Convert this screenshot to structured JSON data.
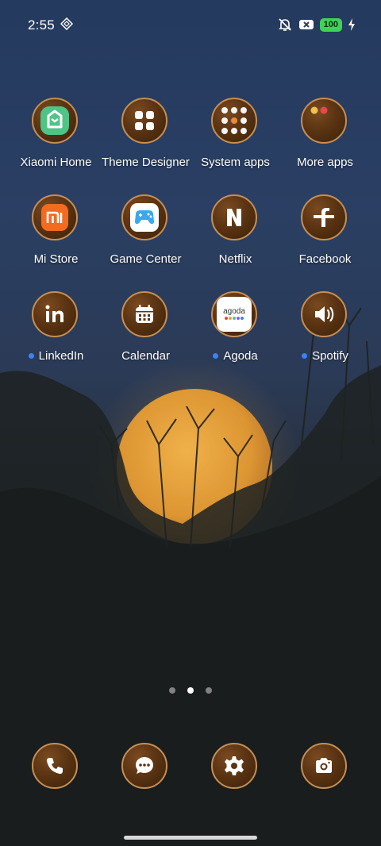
{
  "status_bar": {
    "time": "2:55",
    "battery_level": "100",
    "icons": [
      "nfc-icon",
      "mute-icon",
      "sim-x-icon",
      "battery-icon",
      "charging-icon"
    ]
  },
  "apps": [
    {
      "name": "Xiaomi Home",
      "icon": "xiaomi-home-icon",
      "notification": false
    },
    {
      "name": "Theme Designer",
      "icon": "grid-icon",
      "notification": false
    },
    {
      "name": "System apps",
      "icon": "folder-icon",
      "notification": false
    },
    {
      "name": "More apps",
      "icon": "folder-icon",
      "notification": false
    },
    {
      "name": "Mi Store",
      "icon": "mi-store-icon",
      "notification": false
    },
    {
      "name": "Game Center",
      "icon": "gamepad-icon",
      "notification": false
    },
    {
      "name": "Netflix",
      "icon": "netflix-icon",
      "notification": false
    },
    {
      "name": "Facebook",
      "icon": "facebook-icon",
      "notification": false
    },
    {
      "name": "LinkedIn",
      "icon": "linkedin-icon",
      "notification": true
    },
    {
      "name": "Calendar",
      "icon": "calendar-icon",
      "notification": false
    },
    {
      "name": "Agoda",
      "icon": "agoda-icon",
      "notification": true,
      "icon_text": "agoda"
    },
    {
      "name": "Spotify",
      "icon": "speaker-icon",
      "notification": true
    }
  ],
  "pager": {
    "pages": 3,
    "active": 2
  },
  "dock": [
    {
      "icon": "phone-icon"
    },
    {
      "icon": "messages-icon"
    },
    {
      "icon": "settings-icon"
    },
    {
      "icon": "camera-icon"
    }
  ],
  "colors": {
    "icon_fill": "#5b3413",
    "icon_border": "#c58f55",
    "notification_dot": "#3b82f6",
    "battery": "#3fd25b",
    "moon": "#e9a53c"
  }
}
